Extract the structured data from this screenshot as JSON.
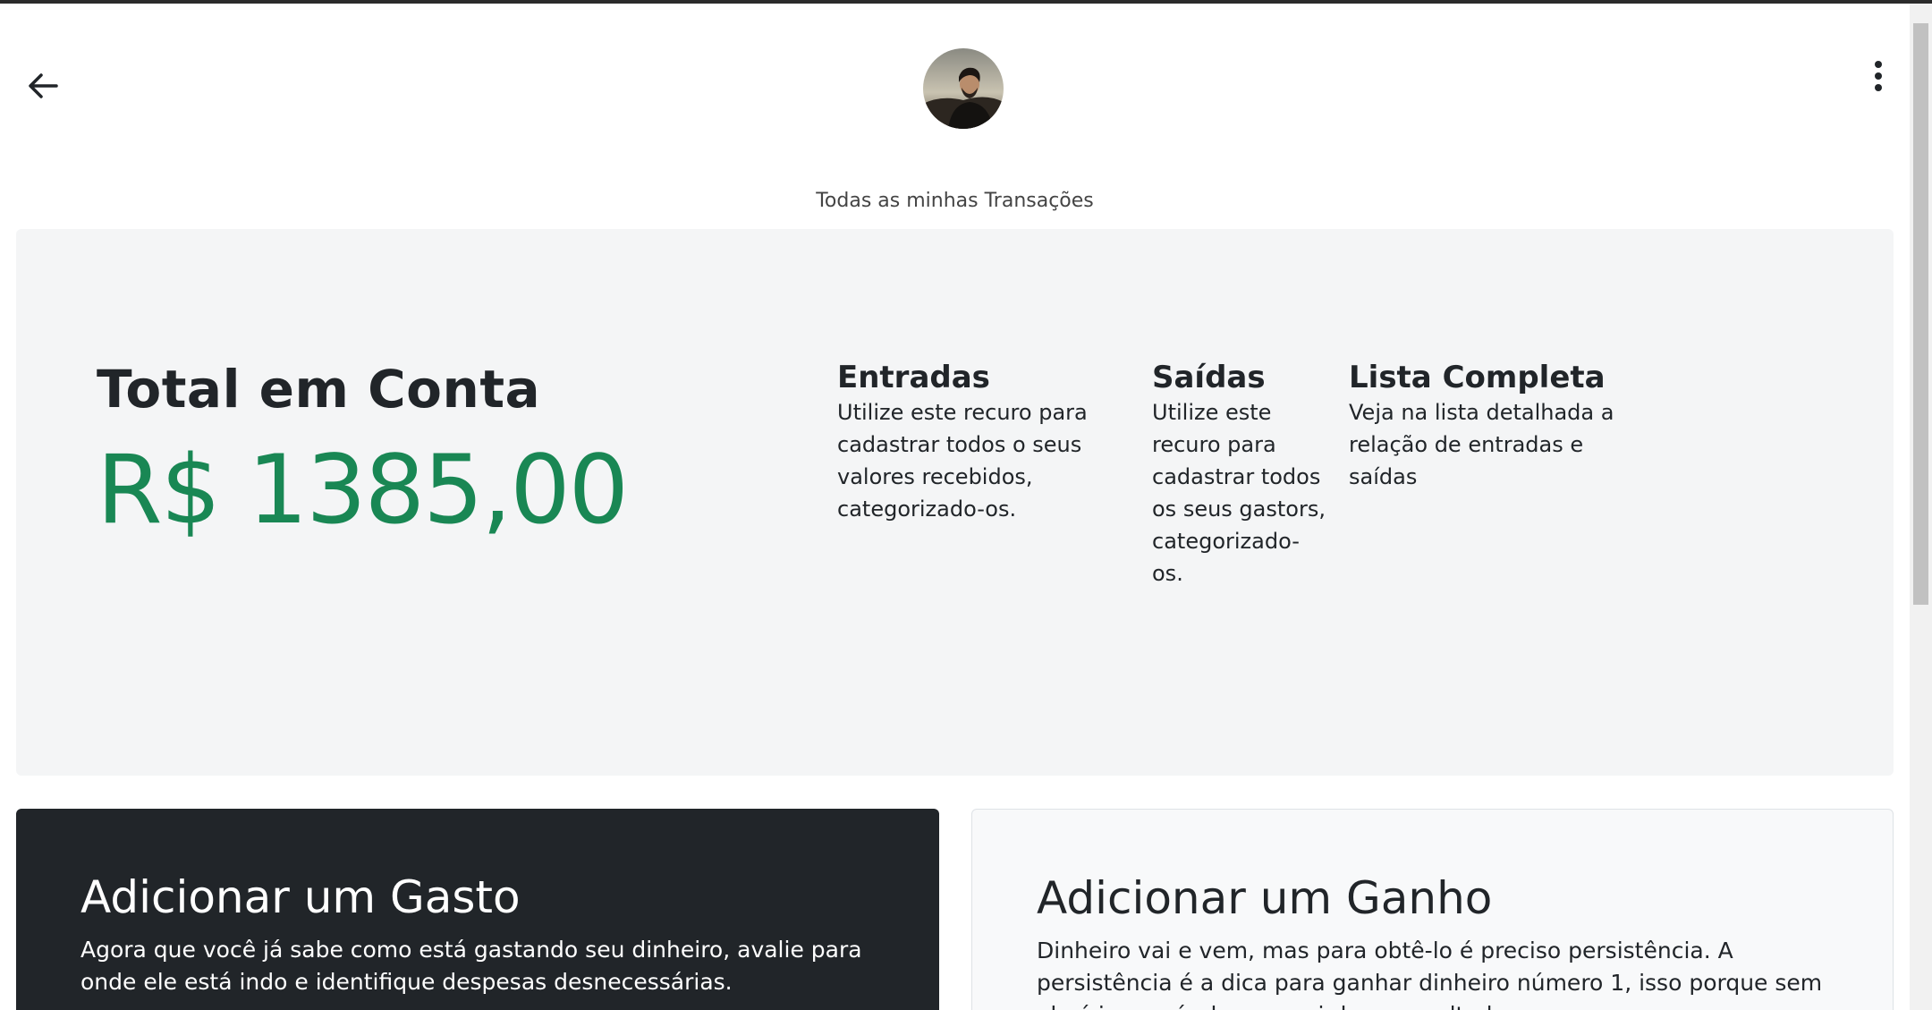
{
  "header": {
    "back_icon": "arrow-left-icon",
    "menu_icon": "kebab-menu-icon",
    "avatar_alt": "profile photo",
    "subtitle": "Todas as minhas Transações"
  },
  "hero": {
    "title": "Total em Conta",
    "amount": "R$ 1385,00",
    "amount_color": "#198754",
    "features": [
      {
        "title": "Entradas",
        "text": "Utilize este recuro para cadastrar todos o seus valores recebidos, categorizado-os."
      },
      {
        "title": "Saídas",
        "text": "Utilize este recuro para cadastrar todos os seus gastors, categorizado-os."
      },
      {
        "title": "Lista Completa",
        "text": "Veja na lista detalhada a relação de entradas e saídas"
      }
    ]
  },
  "cards": {
    "expense": {
      "title": "Adicionar um Gasto",
      "text": "Agora que você já sabe como está gastando seu dinheiro, avalie para onde ele está indo e identifique despesas desnecessárias."
    },
    "income": {
      "title": "Adicionar um Ganho",
      "text": "Dinheiro vai e vem, mas para obtê-lo é preciso persistência. A persistência é a dica para ganhar dinheiro número 1, isso porque sem ela é impossível conseguir bons resultados."
    }
  }
}
